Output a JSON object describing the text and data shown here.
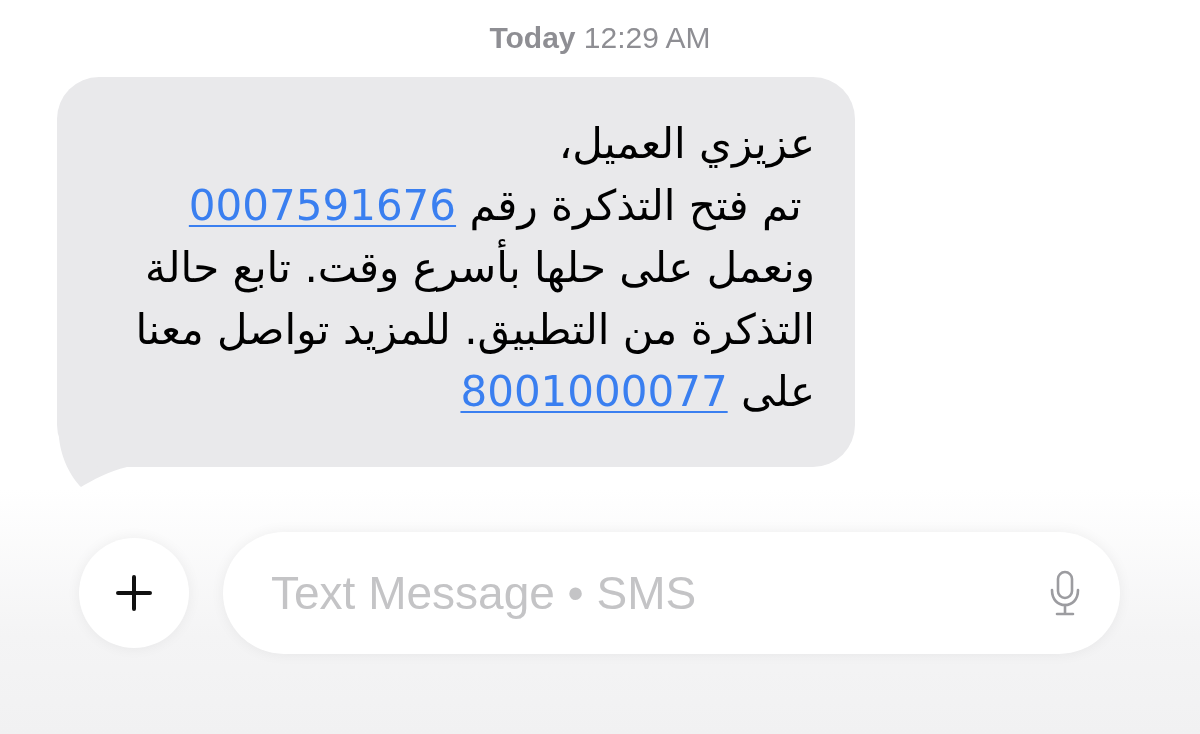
{
  "timestamp": {
    "day": "Today",
    "time": "12:29 AM"
  },
  "message": {
    "lines": [
      [
        {
          "kind": "text",
          "text": "عزيزي العميل،"
        }
      ],
      [
        {
          "kind": "text",
          "text": " تم فتح التذكرة رقم "
        },
        {
          "kind": "link",
          "text": "0007591676"
        }
      ],
      [
        {
          "kind": "text",
          "text": "ونعمل على حلها بأسرع وقت. تابع حالة"
        }
      ],
      [
        {
          "kind": "text",
          "text": "التذكرة من التطبيق. للمزيد تواصل معنا"
        }
      ],
      [
        {
          "kind": "text",
          "text": "على "
        },
        {
          "kind": "link",
          "text": "8001000077"
        }
      ]
    ]
  },
  "composer": {
    "placeholder": "Text Message • SMS"
  }
}
